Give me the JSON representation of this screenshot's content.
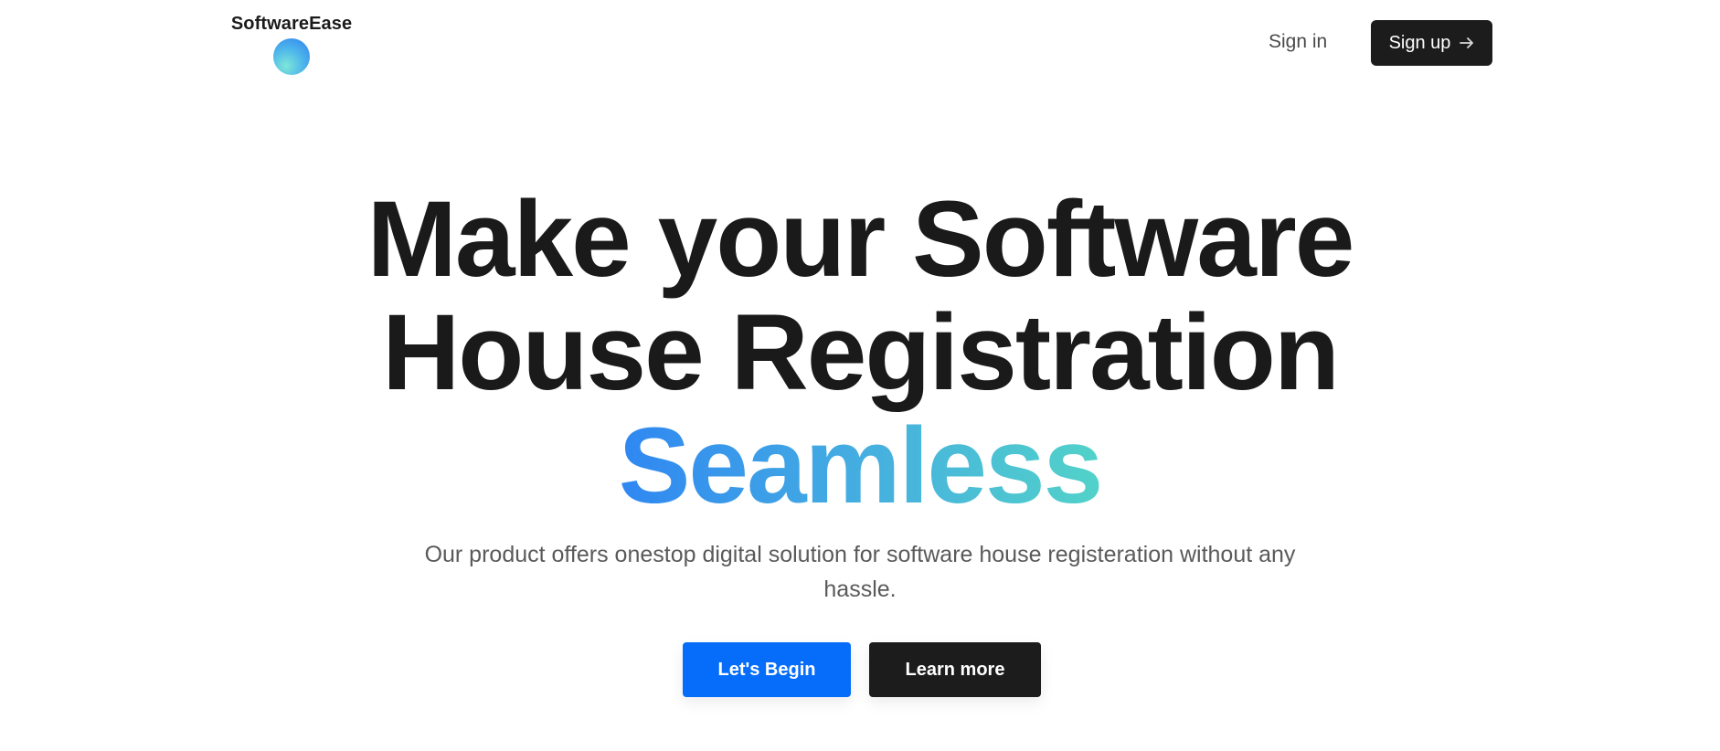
{
  "header": {
    "brand_name": "SoftwareEase",
    "logo_icon": "gradient-circle-logo",
    "signin_label": "Sign in",
    "signup_label": "Sign up",
    "signup_icon": "arrow-right-icon"
  },
  "hero": {
    "title_line1": "Make your Software",
    "title_line2": "House Registration",
    "title_accent": "Seamless",
    "subtitle": "Our product offers onestop digital solution for software house registeration without any hassle.",
    "primary_cta": "Let's Begin",
    "secondary_cta": "Learn more"
  },
  "colors": {
    "primary_button": "#066dfa",
    "dark_button": "#1c1c1c",
    "accent_gradient_start": "#2f87f2",
    "accent_gradient_end": "#52d2c9",
    "text": "#1a1a1a"
  }
}
